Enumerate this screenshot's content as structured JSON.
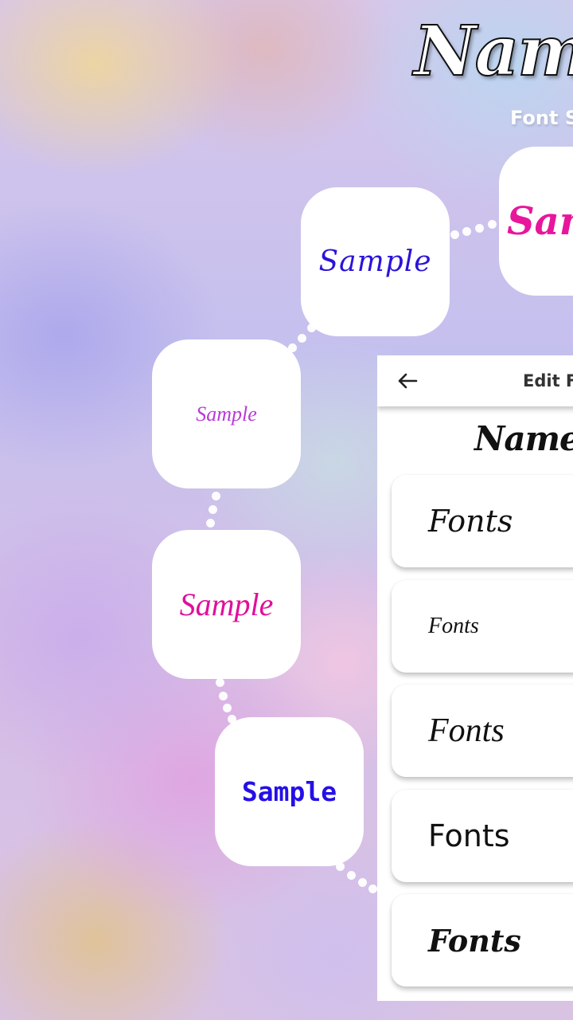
{
  "header": {
    "title": "Name",
    "subtitle": "Font S"
  },
  "sample_tiles": [
    {
      "label": "Sam",
      "color": "#e8169b"
    },
    {
      "label": "Sample",
      "color": "#2a14d8"
    },
    {
      "label": "Sample",
      "color": "#b93bd6"
    },
    {
      "label": "Sample",
      "color": "#e0109a"
    },
    {
      "label": "Sample",
      "color": "#2410e6"
    }
  ],
  "phone_preview": {
    "toolbar": {
      "back_icon": "arrow-left-icon",
      "title": "Edit F"
    },
    "heading": "Name S",
    "font_options": [
      {
        "label": "Fonts"
      },
      {
        "label": "Fonts"
      },
      {
        "label": "Fonts"
      },
      {
        "label": "Fonts"
      },
      {
        "label": "Fonts"
      }
    ]
  }
}
